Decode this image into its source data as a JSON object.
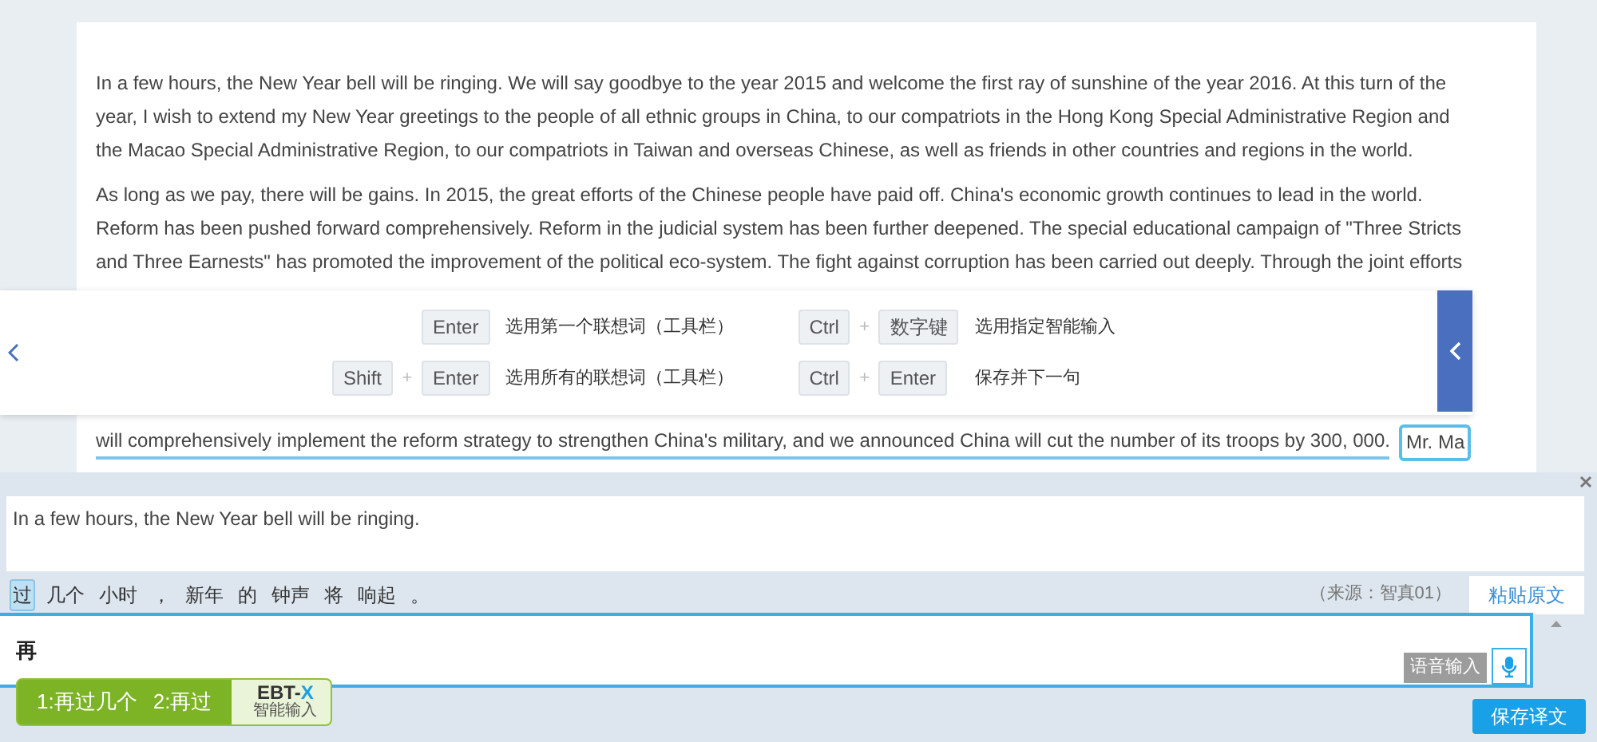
{
  "document": {
    "paragraphs": [
      {
        "lines": [
          "In a few hours, the New Year bell will be ringing. We will say goodbye to the year 2015 and welcome the first ray of sunshine of the year 2016. At this turn of the",
          "year, I wish to extend my New Year greetings to the people of all ethnic groups in China, to our compatriots in the Hong Kong Special Administrative Region and",
          "the Macao Special Administrative Region, to our compatriots in Taiwan and overseas Chinese, as well as friends in other countries and regions in the world."
        ]
      },
      {
        "lines": [
          "As long as we pay, there will be gains. In 2015, the great efforts of the Chinese people have paid off. China's economic growth continues to lead in the world.",
          "Reform has been pushed forward comprehensively. Reform in the judicial system has been further deepened. The special educational campaign of \"Three Stricts",
          "and Three Earnests\" has promoted the improvement of the political eco-system. The fight against corruption has been carried out deeply. Through the joint efforts"
        ]
      }
    ],
    "current_segment": "will comprehensively implement the reform strategy to strengthen China's military, and we announced China will cut the number of its troops by 300, 000.",
    "next_segment": "Mr. Ma"
  },
  "shortcuts": {
    "joiner": "+",
    "columns": [
      [
        {
          "keys": [
            "Enter"
          ],
          "description": "选用第一个联想词（工具栏）"
        },
        {
          "keys": [
            "Shift",
            "Enter"
          ],
          "description": "选用所有的联想词（工具栏）"
        }
      ],
      [
        {
          "keys": [
            "Ctrl",
            "数字键"
          ],
          "description": "选用指定智能输入"
        },
        {
          "keys": [
            "Ctrl",
            "Enter"
          ],
          "description": "保存并下一句"
        }
      ]
    ]
  },
  "editor": {
    "source_text": "In a few hours, the New Year bell will be ringing.",
    "tokens": [
      {
        "text": "过",
        "selected": true
      },
      {
        "text": "几个",
        "selected": false
      },
      {
        "text": "小时",
        "selected": false
      },
      {
        "text": "，",
        "selected": false
      },
      {
        "text": "新年",
        "selected": false
      },
      {
        "text": "的",
        "selected": false
      },
      {
        "text": "钟声",
        "selected": false
      },
      {
        "text": "将",
        "selected": false
      },
      {
        "text": "响起",
        "selected": false
      },
      {
        "text": "。",
        "selected": false
      }
    ],
    "source_label": "（来源：智真01）",
    "paste_button": "粘贴原文",
    "translation_value": "再",
    "voice_tooltip": "语音输入",
    "candidates": [
      "1:再过几个",
      "2:再过"
    ],
    "brand": "EBT-X",
    "brand_sub": "智能输入",
    "save_button": "保存译文"
  }
}
